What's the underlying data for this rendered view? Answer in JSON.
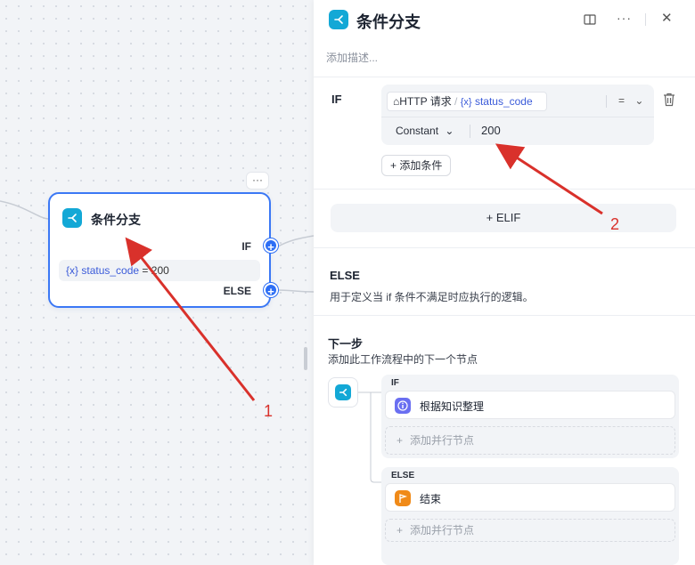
{
  "canvas": {
    "more_label": "···",
    "node": {
      "title": "条件分支",
      "if_label": "IF",
      "else_label": "ELSE",
      "condition_prefix": "{x}",
      "condition_var": "status_code",
      "condition_op": "=",
      "condition_value": "200",
      "handle_plus": "+"
    }
  },
  "panel": {
    "title": "条件分支",
    "dots_label": "···",
    "close_label": "✕",
    "description_placeholder": "添加描述...",
    "if_label": "IF",
    "condition": {
      "source_node": "HTTP 请求",
      "slash": "/",
      "var_prefix": "{x}",
      "variable": "status_code",
      "operator": "=",
      "value_type": "Constant",
      "value": "200"
    },
    "add_condition_label": "+ 添加条件",
    "elif_label": "+ ELIF",
    "else_title": "ELSE",
    "else_description": "用于定义当 if 条件不满足时应执行的逻辑。",
    "next_step": {
      "title": "下一步",
      "description": "添加此工作流程中的下一个节点",
      "branches": [
        {
          "label": "IF",
          "node_label": "根据知识整理",
          "node_icon": "info-icon",
          "node_color": "#6a6ff1",
          "add_parallel_label": "添加并行节点"
        },
        {
          "label": "ELSE",
          "node_label": "结束",
          "node_icon": "end-flag-icon",
          "node_color": "#f08a18",
          "add_parallel_label": "添加并行节点"
        }
      ]
    }
  },
  "annotations": {
    "label_1": "1",
    "label_2": "2",
    "arrow_color": "#d9312b"
  },
  "colors": {
    "accent": "#2d6ef5",
    "node_icon_bg": "#13a8d6",
    "variable_text": "#3b5bd9"
  }
}
